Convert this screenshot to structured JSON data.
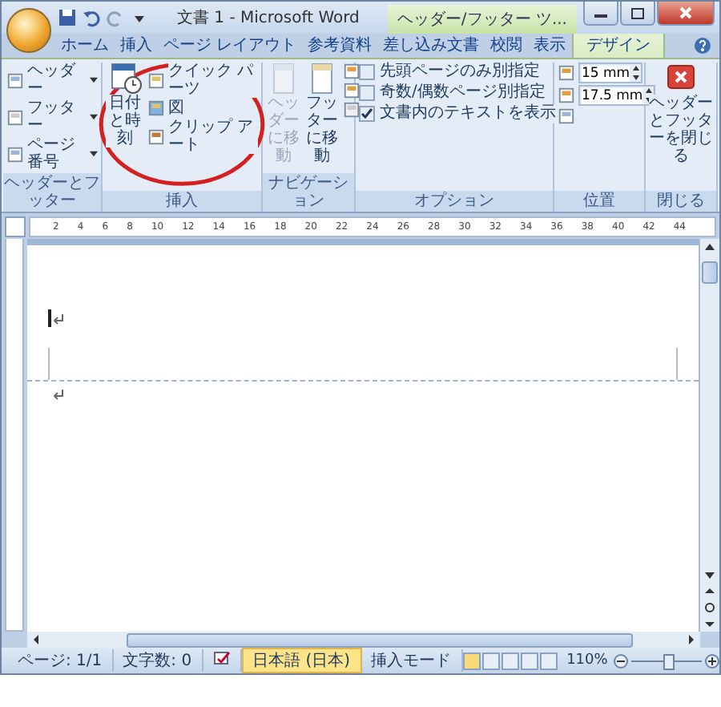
{
  "window": {
    "title": "文書 1 - Microsoft Word",
    "context_tab": "ヘッダー/フッター ツ..."
  },
  "tabs": [
    {
      "label": "ホーム",
      "selected": false
    },
    {
      "label": "挿入",
      "selected": false
    },
    {
      "label": "ページ レイアウト",
      "selected": false
    },
    {
      "label": "参考資料",
      "selected": false
    },
    {
      "label": "差し込み文書",
      "selected": false
    },
    {
      "label": "校閲",
      "selected": false
    },
    {
      "label": "表示",
      "selected": false
    },
    {
      "label": "デザイン",
      "selected": true
    }
  ],
  "ribbon": {
    "groups": [
      {
        "kind": "list",
        "label": "ヘッダーとフッター",
        "items": [
          "ヘッダー",
          "フッター",
          "ページ番号"
        ]
      },
      {
        "kind": "insert",
        "label": "挿入",
        "large": "日付と時刻",
        "items": [
          "クイック パーツ",
          "図",
          "クリップ アート"
        ]
      },
      {
        "kind": "nav",
        "label": "ナビゲーション",
        "buttons": [
          {
            "label": "ヘッダーに移動",
            "disabled": true
          },
          {
            "label": "フッターに移動",
            "disabled": false
          }
        ]
      },
      {
        "kind": "checks",
        "label": "オプション",
        "items": [
          {
            "label": "先頭ページのみ別指定",
            "checked": false
          },
          {
            "label": "奇数/偶数ページ別指定",
            "checked": false
          },
          {
            "label": "文書内のテキストを表示",
            "checked": true
          }
        ]
      },
      {
        "kind": "position",
        "label": "位置",
        "spinners": [
          "15 mm",
          "17.5 mm"
        ]
      },
      {
        "kind": "close",
        "label": "閉じる",
        "button": "ヘッダーとフッターを閉じる"
      }
    ]
  },
  "ruler": {
    "labels": [
      "2",
      "4",
      "6",
      "8",
      "10",
      "12",
      "14",
      "16",
      "18",
      "20",
      "22",
      "24",
      "26",
      "28",
      "30",
      "32",
      "34",
      "36",
      "38",
      "40",
      "42",
      "44"
    ]
  },
  "status_bar": {
    "items": [
      {
        "kind": "text",
        "label": "ページ: 1/1"
      },
      {
        "kind": "text",
        "label": "文字数: 0"
      },
      {
        "kind": "icon"
      },
      {
        "kind": "highlight",
        "label": "日本語 (日本)"
      },
      {
        "kind": "text",
        "label": "挿入モード"
      }
    ],
    "zoom": "110%",
    "zoom_slider": {
      "level": 0.53
    }
  }
}
